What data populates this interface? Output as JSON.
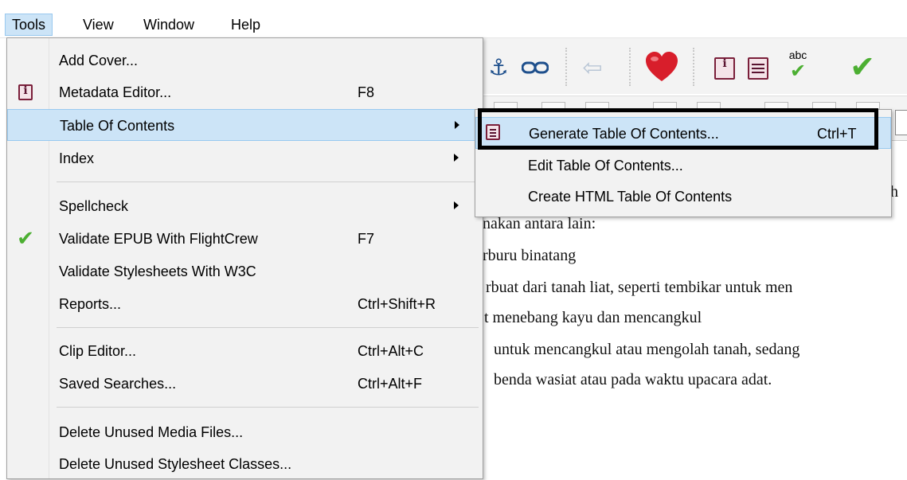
{
  "menubar": {
    "items": [
      {
        "label": "Tools"
      },
      {
        "label": "View"
      },
      {
        "label": "Window"
      },
      {
        "label": "Help"
      }
    ]
  },
  "tools_menu": {
    "add_cover": "Add Cover...",
    "metadata_editor": "Metadata Editor...",
    "metadata_shortcut": "F8",
    "table_of_contents": "Table Of Contents",
    "index": "Index",
    "spellcheck": "Spellcheck",
    "validate_epub": "Validate EPUB With FlightCrew",
    "validate_epub_shortcut": "F7",
    "validate_css": "Validate Stylesheets With W3C",
    "reports": "Reports...",
    "reports_shortcut": "Ctrl+Shift+R",
    "clip_editor": "Clip Editor...",
    "clip_editor_shortcut": "Ctrl+Alt+C",
    "saved_searches": "Saved Searches...",
    "saved_searches_shortcut": "Ctrl+Alt+F",
    "delete_media": "Delete Unused Media Files...",
    "delete_classes": "Delete Unused Stylesheet Classes..."
  },
  "toc_submenu": {
    "generate": "Generate Table Of Contents...",
    "generate_shortcut": "Ctrl+T",
    "edit": "Edit Table Of Contents...",
    "create_html": "Create HTML Table Of Contents"
  },
  "toolbar": {
    "abc_label": "abc"
  },
  "document": {
    "lines": [
      "h",
      "nakan antara lain:",
      "rburu binatang",
      "rbuat dari tanah liat, seperti tembikar untuk men",
      "t menebang kayu dan mencangkul",
      "untuk mencangkul atau mengolah tanah, sedang",
      "benda wasiat atau pada waktu upacara adat."
    ]
  },
  "colors": {
    "highlight": "#cce4f7",
    "highlight_border": "#99c9ef",
    "menu_bg": "#f2f2f2",
    "check_green": "#4caf32",
    "heart_red": "#d81e2b"
  }
}
